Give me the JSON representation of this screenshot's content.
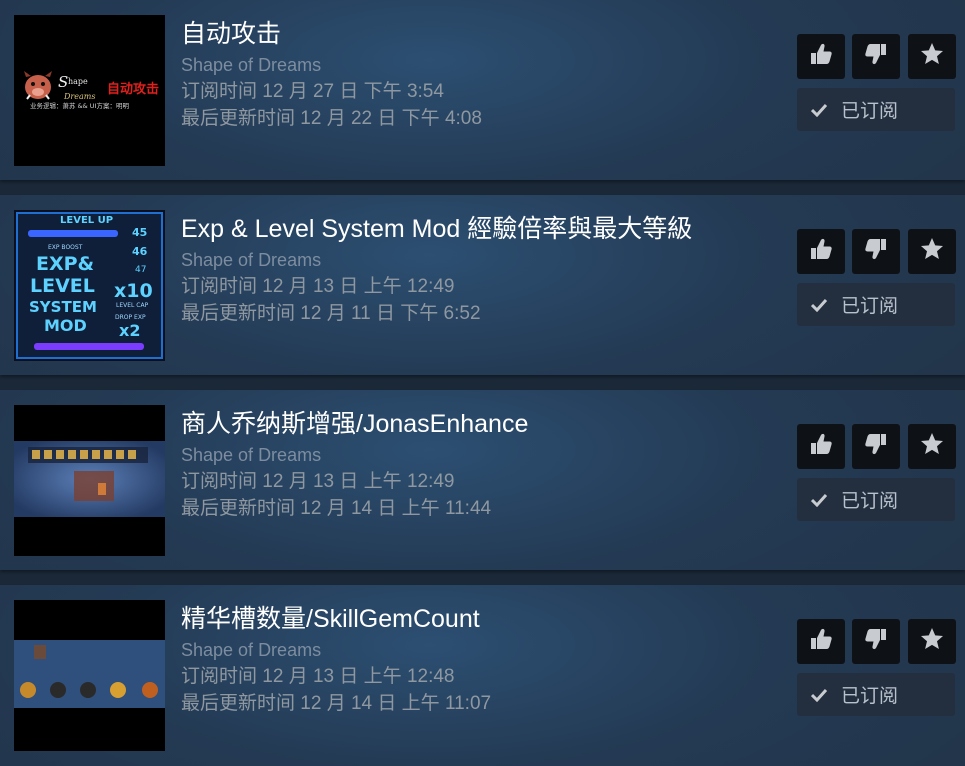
{
  "items": [
    {
      "title": "自动攻击",
      "game": "Shape of Dreams",
      "subscribed_time": "订阅时间 12 月 27 日 下午 3:54",
      "updated_time": "最后更新时间 12 月 22 日 下午 4:08",
      "thumb_text": {
        "title": "自动攻击",
        "subtitle": "业务逻辑：萧苏 && UI方案：明明"
      },
      "subscribed_label": "已订阅"
    },
    {
      "title": "Exp & Level System Mod 經驗倍率與最大等級",
      "game": "Shape of Dreams",
      "subscribed_time": "订阅时间 12 月 13 日 上午 12:49",
      "updated_time": "最后更新时间 12 月 11 日 下午 6:52",
      "thumb_text": {
        "header": "LEVEL UP",
        "boost": "EXP BOOST",
        "main": [
          "EXP&",
          "LEVEL",
          "SYSTEM",
          "MOD"
        ],
        "levels": [
          "45",
          "46",
          "47"
        ],
        "mult1": "x10",
        "cap": "LEVEL CAP",
        "drop": "DROP EXP",
        "mult2": "x2"
      },
      "subscribed_label": "已订阅"
    },
    {
      "title": "商人乔纳斯增强/JonasEnhance",
      "game": "Shape of Dreams",
      "subscribed_time": "订阅时间 12 月 13 日 上午 12:49",
      "updated_time": "最后更新时间 12 月 14 日 上午 11:44",
      "subscribed_label": "已订阅"
    },
    {
      "title": "精华槽数量/SkillGemCount",
      "game": "Shape of Dreams",
      "subscribed_time": "订阅时间 12 月 13 日 上午 12:48",
      "updated_time": "最后更新时间 12 月 14 日 上午 11:07",
      "subscribed_label": "已订阅"
    }
  ],
  "colors": {
    "title": "#ffffff",
    "game": "#7d8d9f",
    "meta": "#8f98a0",
    "button_bg": "#0e1217",
    "subscribed_bg": "#232f3e"
  },
  "icons": {
    "vote_up": "thumbs-up-icon",
    "vote_down": "thumbs-down-icon",
    "favorite": "star-icon",
    "subscribed": "checkmark-icon"
  }
}
